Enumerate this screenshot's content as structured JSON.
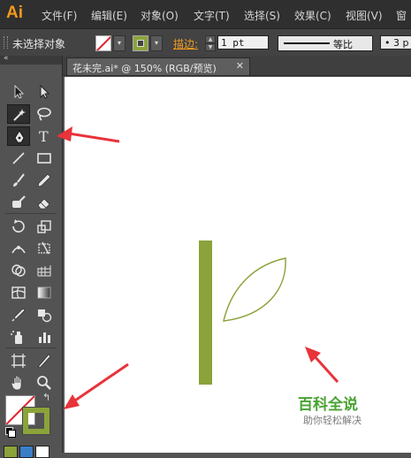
{
  "app": {
    "logo": "Ai"
  },
  "menu": {
    "items": [
      {
        "label": "文件(F)"
      },
      {
        "label": "编辑(E)"
      },
      {
        "label": "对象(O)"
      },
      {
        "label": "文字(T)"
      },
      {
        "label": "选择(S)"
      },
      {
        "label": "效果(C)"
      },
      {
        "label": "视图(V)"
      },
      {
        "label": "窗"
      }
    ]
  },
  "control_bar": {
    "selection_status": "未选择对象",
    "stroke_label": "描边:",
    "stroke_weight": "1 pt",
    "profile_label": "等比",
    "brush_value": "• 3 p"
  },
  "toolbox": {
    "collapse_glyph": "«",
    "swap_glyph": "↰"
  },
  "document": {
    "tab_title": "花未完.ai* @ 150% (RGB/预览)",
    "close_glyph": "✕"
  },
  "artwork": {
    "stem_color": "#8ba33a",
    "leaf_stroke_color": "#8ba33a"
  },
  "colors": {
    "accent_orange": "#f29a1d",
    "annotation_red": "#e8333a",
    "watermark_green": "#4aa333"
  },
  "watermark": {
    "title": "百科全说",
    "subtitle": "助你轻松解决"
  }
}
